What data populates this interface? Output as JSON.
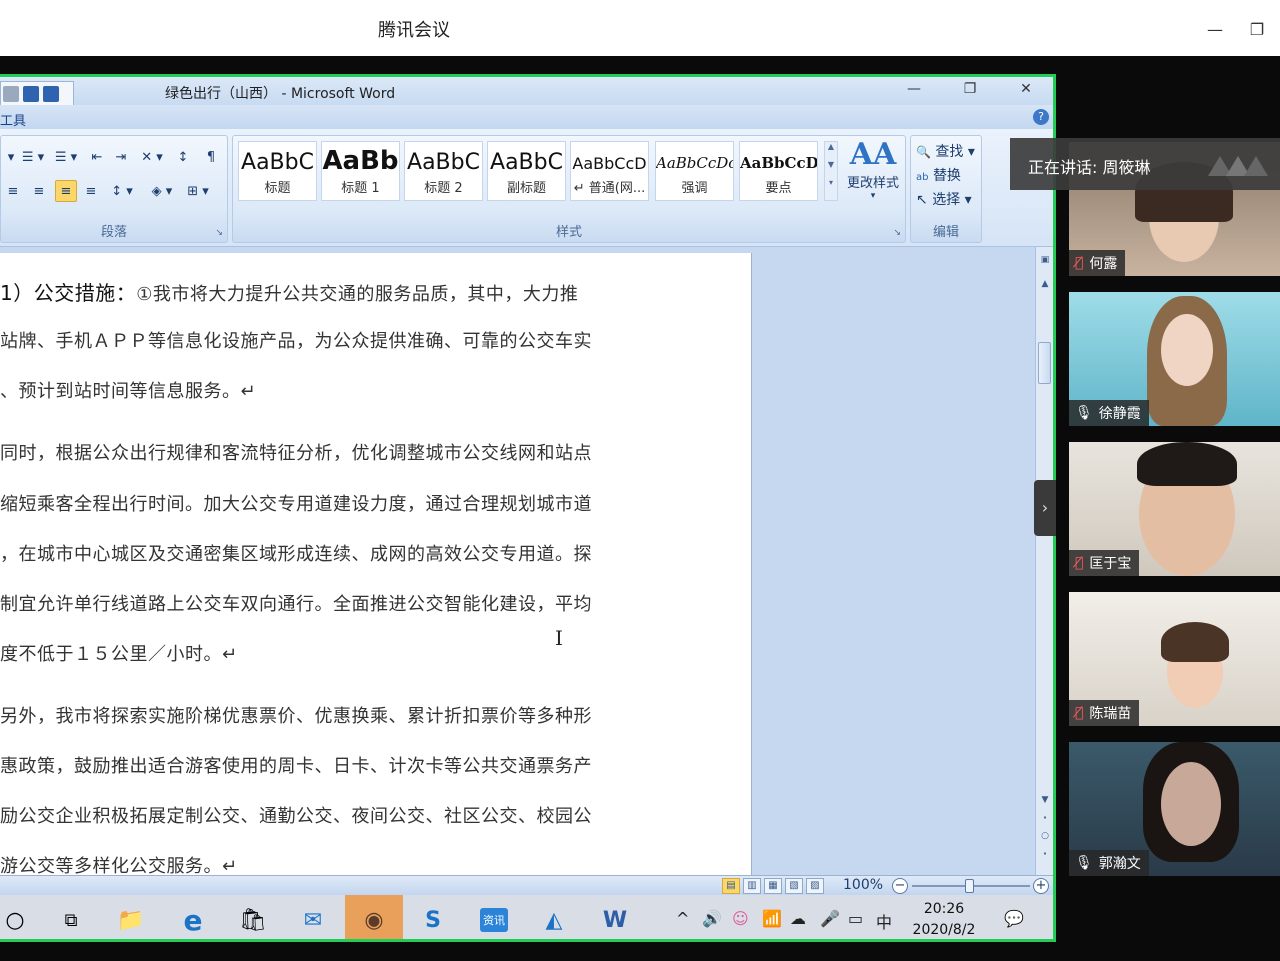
{
  "app": {
    "title": "腾讯会议",
    "minimize_glyph": "—",
    "restore_glyph": "❐"
  },
  "word": {
    "doc_title": "绿色出行（山西） - Microsoft Word",
    "tab_label": "工具",
    "help": "?",
    "caption_min": "—",
    "caption_restore": "❐",
    "caption_close": "✕",
    "paragraph_group": "段落",
    "styles_group": "样式",
    "editing_group": "编辑",
    "styles": [
      {
        "sample": "AaBbC",
        "name": "标题"
      },
      {
        "sample": "AaBb",
        "name": "标题 1"
      },
      {
        "sample": "AaBbC",
        "name": "标题 2"
      },
      {
        "sample": "AaBbC",
        "name": "副标题"
      },
      {
        "sample": "AaBbCcD",
        "name": "↵ 普通(网..."
      },
      {
        "sample": "AaBbCcDc",
        "name": "强调"
      },
      {
        "sample": "AaBbCcD",
        "name": "要点"
      }
    ],
    "change_styles": {
      "glyph": "AA",
      "label": "更改样式",
      "arrow": "▾"
    },
    "find": "查找 ▾",
    "replace": "替换",
    "select": "选择 ▾",
    "find_icon": "🔍",
    "replace_icon": "ab",
    "select_icon": "↖",
    "ribbon_row1": [
      "▾",
      "☰ ▾",
      "☰ ▾",
      "⇤",
      "⇥",
      "✕ ▾",
      "↕",
      "¶"
    ],
    "ribbon_row2": [
      "≡",
      "≡",
      "≡",
      "≡",
      "↕ ▾",
      "◈ ▾",
      "⊞ ▾"
    ],
    "doc": {
      "lines": [
        {
          "lead": "1）公交措施：",
          "text": "①我市将大力提升公共交通的服务品质，其中，大力推"
        },
        {
          "lead": "",
          "text": "站牌、手机ＡＰＰ等信息化设施产品，为公众提供准确、可靠的公交车实"
        },
        {
          "lead": "",
          "text": "、预计到站时间等信息服务。↵"
        },
        {
          "lead": "",
          "text": "同时，根据公众出行规律和客流特征分析，优化调整城市公交线网和站点"
        },
        {
          "lead": "",
          "text": "缩短乘客全程出行时间。加大公交专用道建设力度，通过合理规划城市道"
        },
        {
          "lead": "",
          "text": "，在城市中心城区及交通密集区域形成连续、成网的高效公交专用道。探"
        },
        {
          "lead": "",
          "text": "制宜允许单行线道路上公交车双向通行。全面推进公交智能化建设，平均"
        },
        {
          "lead": "",
          "text": "度不低于１５公里／小时。↵"
        },
        {
          "lead": "",
          "text": "另外，我市将探索实施阶梯优惠票价、优惠换乘、累计折扣票价等多种形"
        },
        {
          "lead": "",
          "text": "惠政策，鼓励推出适合游客使用的周卡、日卡、计次卡等公共交通票务产"
        },
        {
          "lead": "",
          "text": "励公交企业积极拓展定制公交、通勤公交、夜间公交、社区公交、校园公"
        },
        {
          "lead": "",
          "text": "游公交等多样化公交服务。↵"
        }
      ],
      "cursor": "I"
    },
    "zoom": "100%",
    "zoom_minus": "−",
    "zoom_plus": "+",
    "view_buttons": [
      "▤",
      "▥",
      "▦",
      "▧",
      "▨"
    ],
    "scroll_arrows": [
      "▲",
      "▼",
      "⬝",
      "○",
      "⬝"
    ]
  },
  "taskbar": {
    "items": [
      {
        "name": "start-search",
        "glyph": "○"
      },
      {
        "name": "task-view",
        "glyph": "⧉"
      },
      {
        "name": "file-explorer",
        "glyph": "📁"
      },
      {
        "name": "edge",
        "glyph": "e"
      },
      {
        "name": "store",
        "glyph": "🛍"
      },
      {
        "name": "mail",
        "glyph": "✉"
      },
      {
        "name": "photo-app",
        "glyph": "◉"
      },
      {
        "name": "sogou",
        "glyph": "S"
      },
      {
        "name": "tencent-news",
        "glyph": "资讯"
      },
      {
        "name": "tencent-meeting",
        "glyph": "◭"
      },
      {
        "name": "word",
        "glyph": "W"
      }
    ],
    "tray": [
      "^",
      "🔊",
      "☺",
      "📶",
      "☁",
      "🎤",
      "▭",
      "中"
    ],
    "time": "20:26",
    "date": "2020/8/2",
    "notify": "💬"
  },
  "meeting": {
    "speaking_label": "正在讲话: 周筱琳",
    "panel_toggle": "›",
    "participants": [
      {
        "name": "何露",
        "muted": true
      },
      {
        "name": "徐静霞",
        "muted": false
      },
      {
        "name": "匡于宝",
        "muted": true
      },
      {
        "name": "陈瑞苗",
        "muted": true
      },
      {
        "name": "郭瀚文",
        "muted": false
      }
    ],
    "mic_on_glyph": "🎙",
    "mic_off_glyph": "🎙̸"
  }
}
